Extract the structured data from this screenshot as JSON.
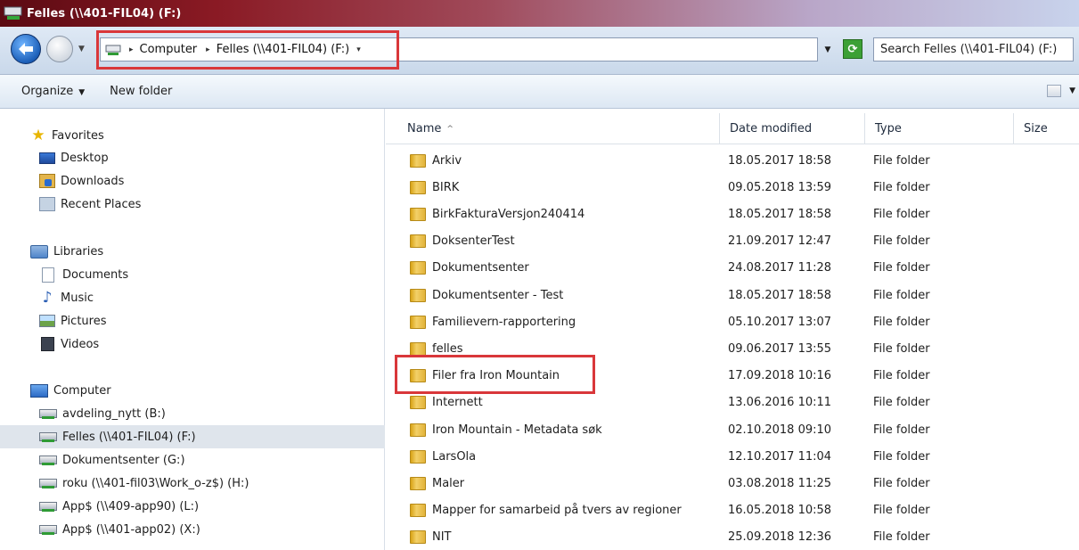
{
  "window": {
    "title": "Felles (\\\\401-FIL04) (F:)"
  },
  "navbar": {
    "breadcrumbs": [
      "Computer",
      "Felles (\\\\401-FIL04) (F:)"
    ],
    "search_placeholder": "Search Felles (\\\\401-FIL04) (F:)"
  },
  "toolbar": {
    "organize": "Organize",
    "new_folder": "New folder"
  },
  "sidebar": {
    "favorites": {
      "label": "Favorites",
      "items": [
        "Desktop",
        "Downloads",
        "Recent Places"
      ]
    },
    "libraries": {
      "label": "Libraries",
      "items": [
        "Documents",
        "Music",
        "Pictures",
        "Videos"
      ]
    },
    "computer": {
      "label": "Computer",
      "drives": [
        "avdeling_nytt (B:)",
        "Felles (\\\\401-FIL04) (F:)",
        "Dokumentsenter (G:)",
        "roku (\\\\401-fil03\\Work_o-z$) (H:)",
        "App$ (\\\\409-app90) (L:)",
        "App$ (\\\\401-app02) (X:)"
      ],
      "selected_index": 1
    }
  },
  "columns": [
    "Name",
    "Date modified",
    "Type",
    "Size"
  ],
  "files": [
    {
      "name": "Arkiv",
      "date": "18.05.2017 18:58",
      "type": "File folder"
    },
    {
      "name": "BIRK",
      "date": "09.05.2018 13:59",
      "type": "File folder"
    },
    {
      "name": "BirkFakturaVersjon240414",
      "date": "18.05.2017 18:58",
      "type": "File folder"
    },
    {
      "name": "DoksenterTest",
      "date": "21.09.2017 12:47",
      "type": "File folder"
    },
    {
      "name": "Dokumentsenter",
      "date": "24.08.2017 11:28",
      "type": "File folder"
    },
    {
      "name": "Dokumentsenter - Test",
      "date": "18.05.2017 18:58",
      "type": "File folder"
    },
    {
      "name": "Familievern-rapportering",
      "date": "05.10.2017 13:07",
      "type": "File folder"
    },
    {
      "name": "felles",
      "date": "09.06.2017 13:55",
      "type": "File folder"
    },
    {
      "name": "Filer fra Iron Mountain",
      "date": "17.09.2018 10:16",
      "type": "File folder"
    },
    {
      "name": "Internett",
      "date": "13.06.2016 10:11",
      "type": "File folder"
    },
    {
      "name": "Iron Mountain - Metadata søk",
      "date": "02.10.2018 09:10",
      "type": "File folder"
    },
    {
      "name": "LarsOla",
      "date": "12.10.2017 11:04",
      "type": "File folder"
    },
    {
      "name": "Maler",
      "date": "03.08.2018 11:25",
      "type": "File folder"
    },
    {
      "name": "Mapper for samarbeid på tvers av regioner",
      "date": "16.05.2018 10:58",
      "type": "File folder"
    },
    {
      "name": "NIT",
      "date": "25.09.2018 12:36",
      "type": "File folder"
    }
  ],
  "highlight_color": "#d9373a"
}
